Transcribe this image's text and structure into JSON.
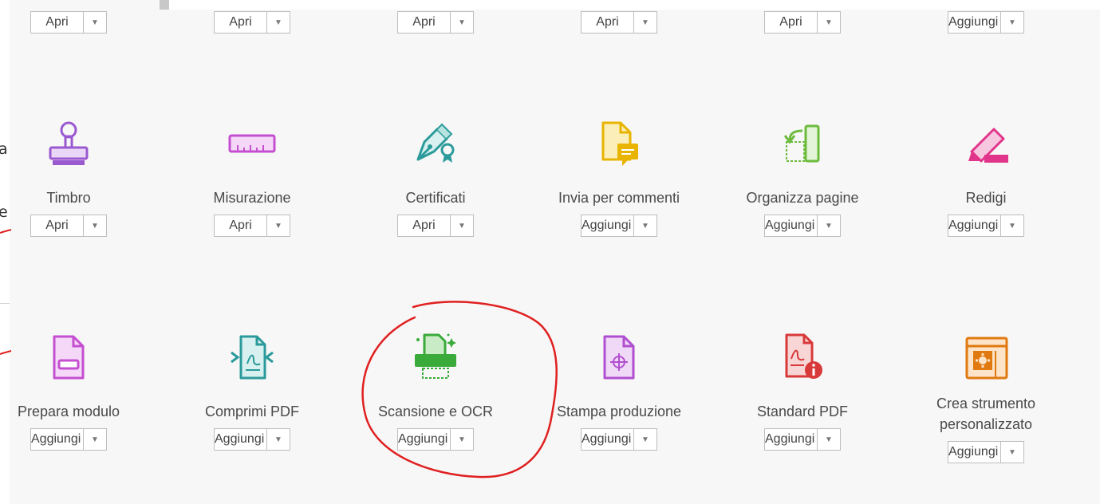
{
  "left_panel": {
    "line_a": "a",
    "line_e": "e"
  },
  "rows": [
    {
      "tools": [
        {
          "button": "Apri"
        },
        {
          "button": "Apri"
        },
        {
          "button": "Apri"
        },
        {
          "button": "Apri"
        },
        {
          "button": "Apri"
        },
        {
          "button": "Aggiungi"
        }
      ]
    },
    {
      "tools": [
        {
          "name": "Timbro",
          "icon": "stamp-icon",
          "button": "Apri"
        },
        {
          "name": "Misurazione",
          "icon": "ruler-icon",
          "button": "Apri"
        },
        {
          "name": "Certificati",
          "icon": "certificate-pen-icon",
          "button": "Apri"
        },
        {
          "name": "Invia per commenti",
          "icon": "send-comments-icon",
          "button": "Aggiungi"
        },
        {
          "name": "Organizza pagine",
          "icon": "organize-pages-icon",
          "button": "Aggiungi"
        },
        {
          "name": "Redigi",
          "icon": "redact-icon",
          "button": "Aggiungi"
        }
      ]
    },
    {
      "tools": [
        {
          "name": "Prepara modulo",
          "icon": "prepare-form-icon",
          "button": "Aggiungi"
        },
        {
          "name": "Comprimi PDF",
          "icon": "compress-pdf-icon",
          "button": "Aggiungi"
        },
        {
          "name": "Scansione e OCR",
          "icon": "scan-ocr-icon",
          "button": "Aggiungi"
        },
        {
          "name": "Stampa produzione",
          "icon": "print-production-icon",
          "button": "Aggiungi"
        },
        {
          "name": "Standard PDF",
          "icon": "pdf-standards-icon",
          "button": "Aggiungi"
        },
        {
          "name_line1": "Crea strumento",
          "name_line2": "personalizzato",
          "icon": "custom-tool-icon",
          "button": "Aggiungi"
        }
      ]
    }
  ],
  "colors": {
    "stamp": "#9b59d0",
    "ruler": "#c44fd0",
    "certificate": "#2b9a9a",
    "send_comments": "#e8b400",
    "organize": "#6dbb3c",
    "redact": "#e0358b",
    "prepare_form": "#c44fd0",
    "compress": "#2b9a9a",
    "scan": "#3aaa3a",
    "print_production": "#b04fd0",
    "pdf_standards": "#d83a3a",
    "custom_tool": "#e07a10",
    "annotation": "#e02020"
  }
}
